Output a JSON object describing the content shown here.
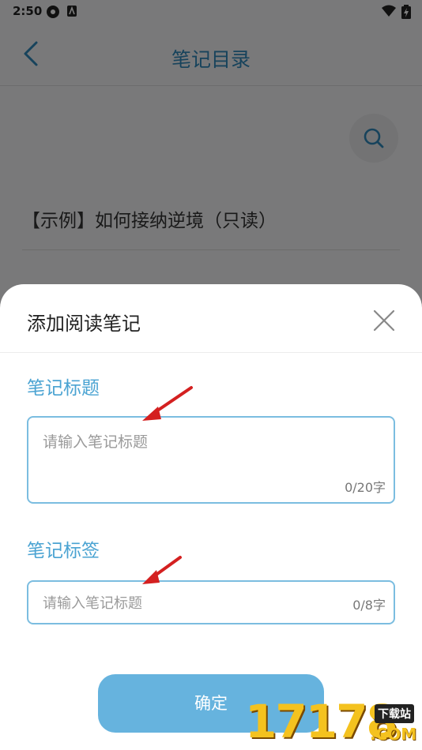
{
  "status_bar": {
    "time": "2:50"
  },
  "header": {
    "title": "笔记目录"
  },
  "list": {
    "items": [
      {
        "label": "【示例】如何接纳逆境（只读）"
      }
    ]
  },
  "dialog": {
    "title": "添加阅读笔记",
    "title_field": {
      "label": "笔记标题",
      "placeholder": "请输入笔记标题",
      "counter": "0/20字"
    },
    "tag_field": {
      "label": "笔记标签",
      "placeholder": "请输入笔记标题",
      "counter": "0/8字"
    },
    "confirm_label": "确定"
  },
  "watermark": {
    "site": "17178",
    "sub": "下载站",
    "domain": ".COM"
  },
  "colors": {
    "accent": "#4aa3d2",
    "button": "#66b3de",
    "arrow": "#d42020"
  }
}
